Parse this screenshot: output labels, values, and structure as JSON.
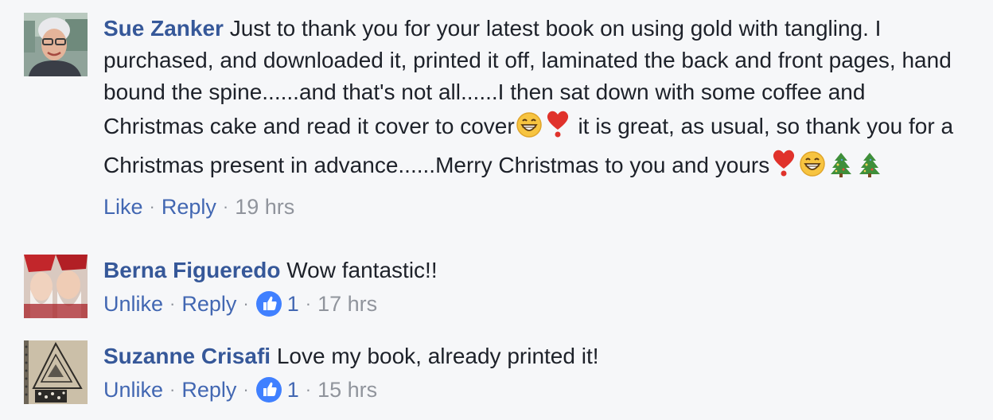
{
  "comments": [
    {
      "author": "Sue Zanker",
      "segments": [
        " Just to thank you for your latest book on using gold with tangling. I purchased, and downloaded it, printed it off, laminated the back and front pages, hand bound the spine......and that's not all......I then sat down with some coffee and Christmas cake and read it cover to cover",
        "it is great, as usual, so thank you for a Christmas present in advance......Merry Christmas to you and yours"
      ],
      "like_label": "Like",
      "reply_label": "Reply",
      "time": "19 hrs",
      "emoji_after_first": [
        "grinning-face-icon",
        "heart-exclamation-icon"
      ],
      "emoji_trailing": [
        "heart-exclamation-icon",
        "grinning-face-icon",
        "christmas-tree-icon",
        "christmas-tree-icon"
      ]
    },
    {
      "author": "Berna Figueredo",
      "text": " Wow fantastic!!",
      "like_label": "Unlike",
      "reply_label": "Reply",
      "like_count": "1",
      "time": "17 hrs"
    },
    {
      "author": "Suzanne Crisafi",
      "text": " Love my book, already printed it!",
      "like_label": "Unlike",
      "reply_label": "Reply",
      "like_count": "1",
      "time": "15 hrs"
    }
  ],
  "separator": "·",
  "colors": {
    "author": "#365899",
    "link": "#4267b2",
    "meta": "#90949c",
    "background": "#f6f7f9",
    "like_badge": "#4080ff"
  }
}
